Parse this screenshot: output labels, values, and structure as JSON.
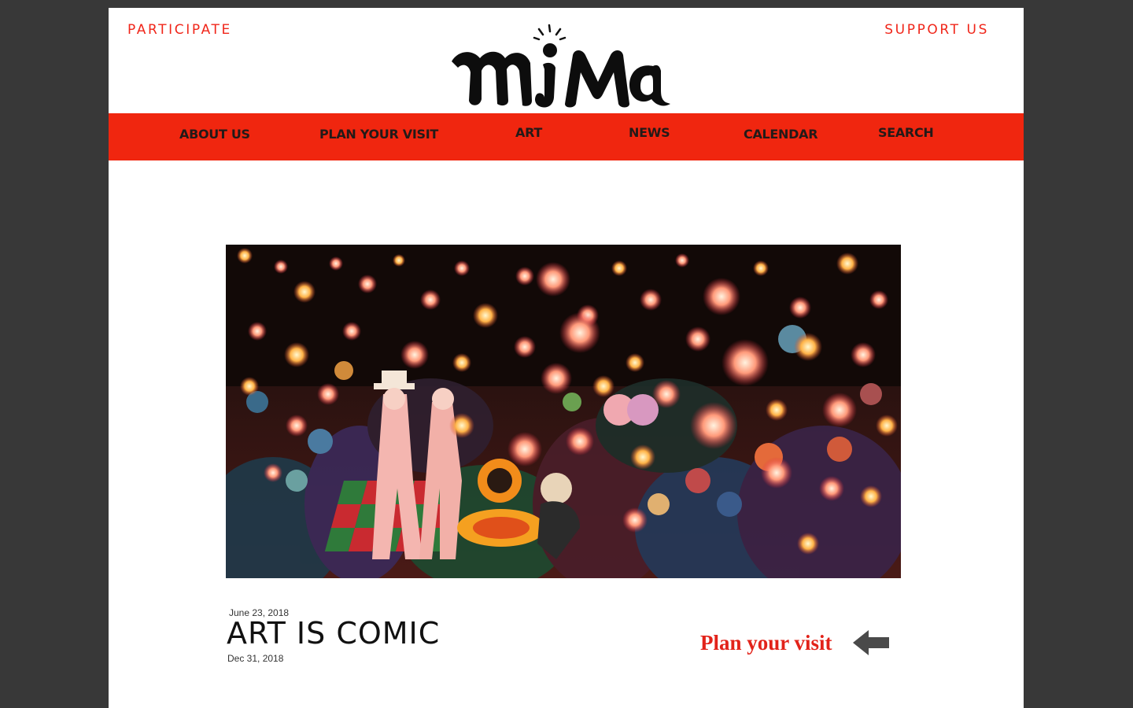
{
  "header": {
    "participate_label": "PARTICIPATE",
    "support_label": "SUPPORT US",
    "logo_text": "miMa"
  },
  "nav": {
    "items": [
      {
        "label": "ABOUT US"
      },
      {
        "label": "PLAN YOUR VISIT"
      },
      {
        "label": "ART"
      },
      {
        "label": "NEWS"
      },
      {
        "label": "CALENDAR"
      },
      {
        "label": "SEARCH"
      }
    ]
  },
  "exhibition": {
    "start_date": "June 23, 2018",
    "title": "ART IS COMIC",
    "end_date": "Dec 31, 2018",
    "image_alt": "colorful-dance-hall-painting"
  },
  "cta": {
    "plan_label": "Plan your visit",
    "arrow_icon": "arrow-left-icon"
  },
  "colors": {
    "accent": "#f0261a",
    "nav_bg": "#f0260f",
    "backdrop": "#383838"
  }
}
